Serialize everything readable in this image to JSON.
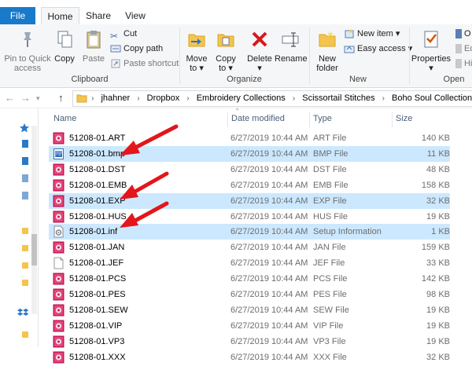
{
  "ribbon_tabs": {
    "file": "File",
    "home": "Home",
    "share": "Share",
    "view": "View"
  },
  "clipboard": {
    "pin": "Pin to Quick access",
    "copy": "Copy",
    "paste": "Paste",
    "cut": "Cut",
    "copy_path": "Copy path",
    "paste_shortcut": "Paste shortcut",
    "label": "Clipboard"
  },
  "organize": {
    "move_to": "Move to",
    "copy_to": "Copy to",
    "delete": "Delete",
    "rename": "Rename",
    "label": "Organize"
  },
  "new_group": {
    "new_folder": "New folder",
    "new_item": "New item",
    "easy_access": "Easy access",
    "label": "New"
  },
  "open_group": {
    "properties": "Properties",
    "label": "Open",
    "partial_open": "O",
    "partial_edit": "Ed",
    "partial_history": "Hi"
  },
  "breadcrumb": [
    "jhahner",
    "Dropbox",
    "Embroidery Collections",
    "Scissortail Stitches",
    "Boho Soul Collection DOWN"
  ],
  "columns": {
    "name": "Name",
    "date": "Date modified",
    "type": "Type",
    "size": "Size"
  },
  "files": [
    {
      "name": "51208-01.ART",
      "date": "6/27/2019 10:44 AM",
      "type": "ART File",
      "size": "140 KB",
      "icon": "embroidery-icon",
      "selected": false
    },
    {
      "name": "51208-01.bmp",
      "date": "6/27/2019 10:44 AM",
      "type": "BMP File",
      "size": "11 KB",
      "icon": "image-icon",
      "selected": true
    },
    {
      "name": "51208-01.DST",
      "date": "6/27/2019 10:44 AM",
      "type": "DST File",
      "size": "48 KB",
      "icon": "embroidery-icon",
      "selected": false
    },
    {
      "name": "51208-01.EMB",
      "date": "6/27/2019 10:44 AM",
      "type": "EMB File",
      "size": "158 KB",
      "icon": "embroidery-icon",
      "selected": false
    },
    {
      "name": "51208-01.EXP",
      "date": "6/27/2019 10:44 AM",
      "type": "EXP File",
      "size": "32 KB",
      "icon": "embroidery-icon",
      "selected": true
    },
    {
      "name": "51208-01.HUS",
      "date": "6/27/2019 10:44 AM",
      "type": "HUS File",
      "size": "19 KB",
      "icon": "embroidery-icon",
      "selected": false
    },
    {
      "name": "51208-01.inf",
      "date": "6/27/2019 10:44 AM",
      "type": "Setup Information",
      "size": "1 KB",
      "icon": "setup-icon",
      "selected": true
    },
    {
      "name": "51208-01.JAN",
      "date": "6/27/2019 10:44 AM",
      "type": "JAN File",
      "size": "159 KB",
      "icon": "embroidery-icon",
      "selected": false
    },
    {
      "name": "51208-01.JEF",
      "date": "6/27/2019 10:44 AM",
      "type": "JEF File",
      "size": "33 KB",
      "icon": "blank-file-icon",
      "selected": false
    },
    {
      "name": "51208-01.PCS",
      "date": "6/27/2019 10:44 AM",
      "type": "PCS File",
      "size": "142 KB",
      "icon": "embroidery-icon",
      "selected": false
    },
    {
      "name": "51208-01.PES",
      "date": "6/27/2019 10:44 AM",
      "type": "PES File",
      "size": "98 KB",
      "icon": "embroidery-icon",
      "selected": false
    },
    {
      "name": "51208-01.SEW",
      "date": "6/27/2019 10:44 AM",
      "type": "SEW File",
      "size": "19 KB",
      "icon": "embroidery-icon",
      "selected": false
    },
    {
      "name": "51208-01.VIP",
      "date": "6/27/2019 10:44 AM",
      "type": "VIP File",
      "size": "19 KB",
      "icon": "embroidery-icon",
      "selected": false
    },
    {
      "name": "51208-01.VP3",
      "date": "6/27/2019 10:44 AM",
      "type": "VP3 File",
      "size": "19 KB",
      "icon": "embroidery-icon",
      "selected": false
    },
    {
      "name": "51208-01.XXX",
      "date": "6/27/2019 10:44 AM",
      "type": "XXX File",
      "size": "32 KB",
      "icon": "embroidery-icon",
      "selected": false
    }
  ],
  "colors": {
    "accent": "#1979ca",
    "selection": "#cce8ff",
    "annotation_arrow": "#e3161b"
  }
}
